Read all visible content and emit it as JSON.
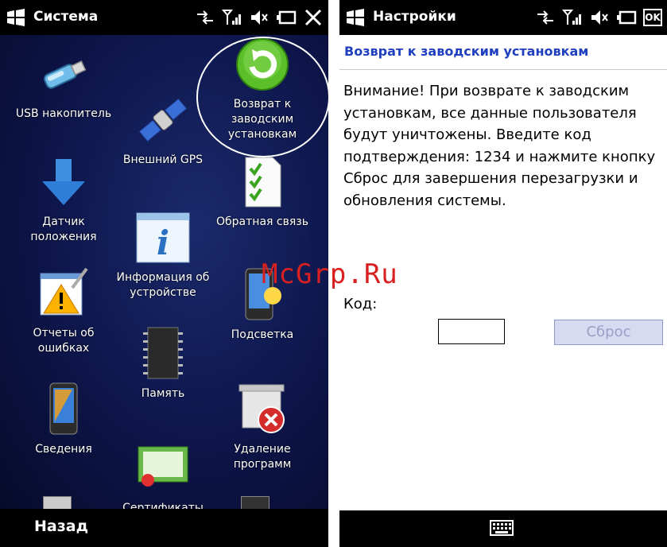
{
  "left": {
    "title": "Система",
    "apps": [
      {
        "label": "USB накопитель",
        "icon": "usb-drive-icon"
      },
      {
        "label": "Внешний GPS",
        "icon": "satellite-icon"
      },
      {
        "label": "Возврат к заводским установкам",
        "icon": "refresh-icon"
      },
      {
        "label": "Датчик положения",
        "icon": "down-arrow-icon"
      },
      {
        "label": "Обратная связь",
        "icon": "checklist-icon"
      },
      {
        "label": "Информация об устройстве",
        "icon": "info-icon"
      },
      {
        "label": "Отчеты об ошибках",
        "icon": "warning-icon"
      },
      {
        "label": "Подсветка",
        "icon": "backlight-icon"
      },
      {
        "label": "Память",
        "icon": "memory-chip-icon"
      },
      {
        "label": "Сведения",
        "icon": "phone-icon"
      },
      {
        "label": "Удаление программ",
        "icon": "remove-program-icon"
      },
      {
        "label": "Сертификаты",
        "icon": "certificate-icon"
      }
    ],
    "back_label": "Назад"
  },
  "right": {
    "title": "Настройки",
    "ok_label": "OK",
    "header": "Возврат к заводским установкам",
    "message": "Внимание! При возврате к заводским установкам, все данные пользователя будут уничтожены. Введите код подтверждения: 1234 и нажмите кнопку Сброс для завершения перезагрузки и обновления системы.",
    "code_label": "Код:",
    "code_value": "",
    "reset_label": "Сброс"
  },
  "watermark": "McGrp.Ru",
  "colors": {
    "header": "#1f3fbf",
    "watermark": "#d92020"
  }
}
